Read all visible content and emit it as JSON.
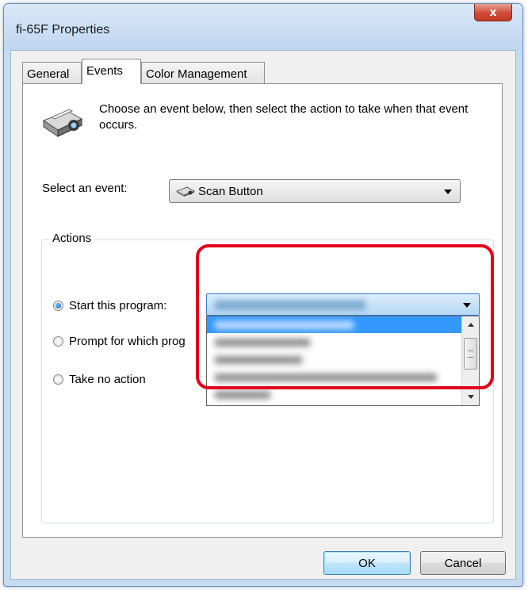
{
  "window": {
    "title": "fi-65F Properties",
    "close_label": "x"
  },
  "tabs": [
    {
      "label": "General"
    },
    {
      "label": "Events"
    },
    {
      "label": "Color Management"
    }
  ],
  "events_tab": {
    "intro_text": "Choose an event below, then select the action to take when that event occurs.",
    "event_label": "Select an event:",
    "event_value": "Scan Button",
    "actions_label": "Actions",
    "options": [
      {
        "label": "Start this program:",
        "checked": true
      },
      {
        "label": "Prompt for which prog",
        "checked": false
      },
      {
        "label": "Take no action",
        "checked": false
      }
    ]
  },
  "buttons": {
    "ok": "OK",
    "cancel": "Cancel"
  },
  "colors": {
    "highlight": "#e3001b",
    "selection": "#3399ff"
  },
  "icons": [
    "close-icon",
    "scanner-icon",
    "scanner-small-icon",
    "chevron-down-icon",
    "radio-icon",
    "scroll-up-icon",
    "scroll-down-icon"
  ]
}
